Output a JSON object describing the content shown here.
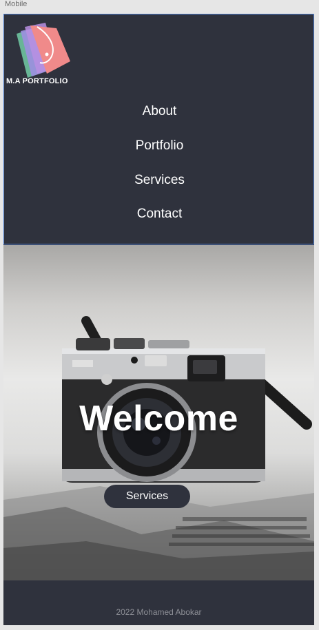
{
  "frame": {
    "label": "Mobile"
  },
  "header": {
    "logo_text": "M.A PORTFOLIO",
    "nav": [
      {
        "label": "About"
      },
      {
        "label": "Portfolio"
      },
      {
        "label": "Services"
      },
      {
        "label": "Contact"
      }
    ]
  },
  "hero": {
    "heading": "Welcome",
    "button_label": "Services"
  },
  "footer": {
    "text": "2022 Mohamed Abokar"
  },
  "colors": {
    "background": "#2f323d",
    "text": "#ffffff",
    "footer_text": "#8d8f96",
    "selection_border": "#4f7fd0"
  },
  "icons": [
    "logo-icon",
    "camera-image"
  ]
}
